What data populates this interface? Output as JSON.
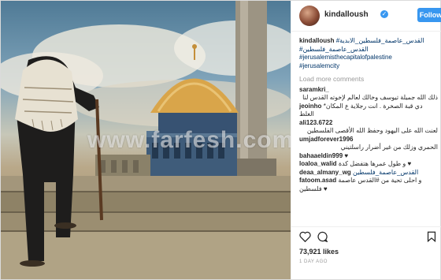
{
  "watermark": "www.farfesh.com",
  "post": {
    "username": "kindalloush",
    "follow_label": "Follow",
    "caption_tags": [
      "#القدس_عاصمة_فلسطين_الابدية",
      "#القدس_عاصمة_فلسطين",
      "#jerusalemisthecapitalofpalestine",
      "#jerusalemcity"
    ],
    "load_more": "Load more comments",
    "likes": "73,921 likes",
    "time_ago": "1 DAY AGO"
  },
  "comments": [
    {
      "user": "saramkri_",
      "text": "ذلك الله جميلة تيوسف وخالك لعالم لإخوته القدس لنا"
    },
    {
      "user": "jeoinho",
      "text": "*دي قبة الصخرة . انت رجلاية ع المكان الغلط"
    },
    {
      "user": "ali123.6722",
      "text": "لعنت الله على اليهود وحفظ الله الأقصى الفلسطين"
    },
    {
      "user": "umjadforever1996",
      "text": "الحمري وزلك من غير أضرار راسلتيني"
    },
    {
      "user": "bahaaeldin999",
      "text": "♥"
    },
    {
      "user": "loaloa_walid",
      "text": "و طول عمرها هتفضل كدة ♥"
    },
    {
      "user": "deaa_almany_wg",
      "text": "القدس_عاصمة_فلسطين"
    },
    {
      "user": "fatoom.asad",
      "text": "و احلى تحية من #القدس عاصمة فلسطين ♥"
    }
  ],
  "colors": {
    "accent": "#3897f0",
    "tag": "#003569",
    "dome": "#d9a54a"
  },
  "icons": [
    "heart-icon",
    "comment-icon",
    "bookmark-icon",
    "verified-icon"
  ]
}
